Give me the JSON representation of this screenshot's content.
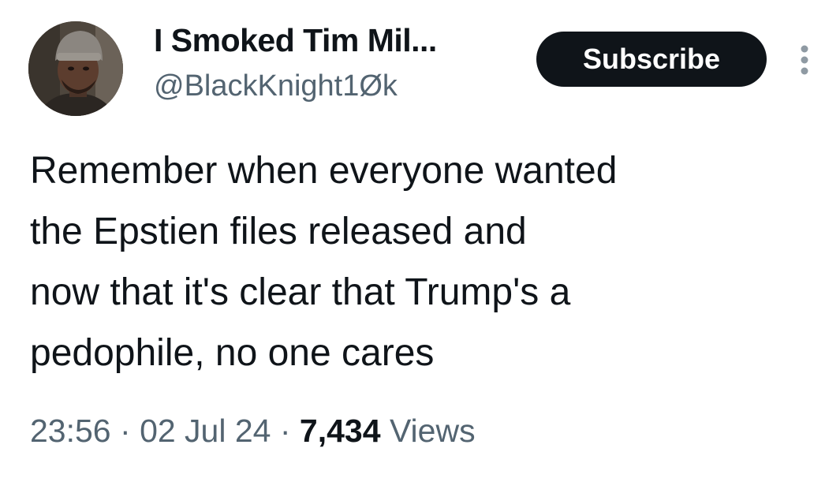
{
  "author": {
    "display_name": "I Smoked Tim Mil...",
    "handle": "@BlackKnight1Øk"
  },
  "header": {
    "subscribe_label": "Subscribe",
    "more_icon": "more-vertical-icon"
  },
  "tweet": {
    "lines": [
      "Remember when everyone wanted",
      "the Epstien files released and",
      "now that it's clear that Trump's a",
      "pedophile, no one cares"
    ]
  },
  "meta": {
    "time": "23:56",
    "separator": "·",
    "date": "02 Jul 24",
    "views_count": "7,434",
    "views_label": "Views"
  },
  "colors": {
    "text_primary": "#0f1419",
    "text_secondary": "#536471",
    "button_bg": "#0f1419",
    "button_text": "#ffffff"
  }
}
